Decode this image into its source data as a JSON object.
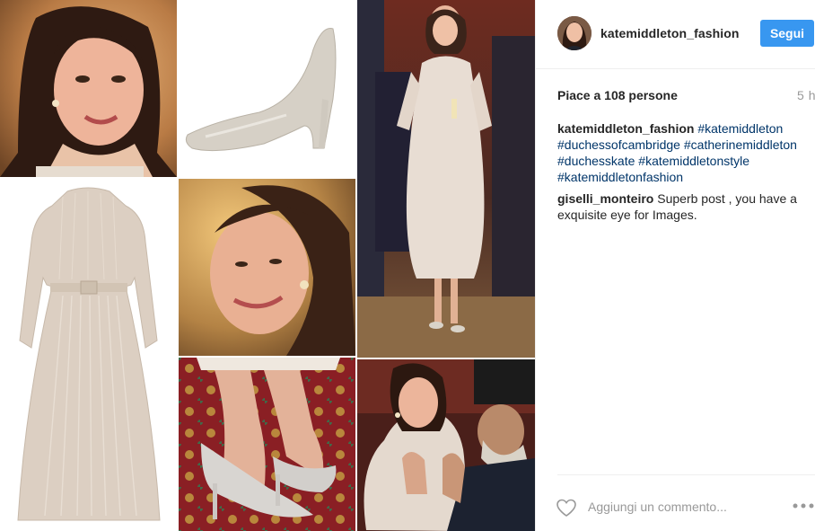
{
  "post": {
    "username": "katemiddleton_fashion",
    "follow_label": "Segui",
    "likes_text": "Piace a 108 persone",
    "time_ago": "5 h"
  },
  "caption": {
    "user": "katemiddleton_fashion",
    "tags": [
      "#katemiddleton",
      "#duchessofcambridge",
      "#catherinemiddleton",
      "#duchesskate",
      "#katemiddletonstyle",
      "#katemiddletonfashion"
    ]
  },
  "comment": {
    "user": "giselli_monteiro",
    "text": "Superb post , you have a exquisite eye for Images."
  },
  "add_comment": {
    "placeholder": "Aggiungi un commento..."
  },
  "icons": {
    "heart": "heart-outline-icon",
    "more": "more-options-icon"
  },
  "colors": {
    "follow_button": "#3897f0",
    "hashtag": "#003569",
    "text": "#262626",
    "muted": "#999999"
  }
}
